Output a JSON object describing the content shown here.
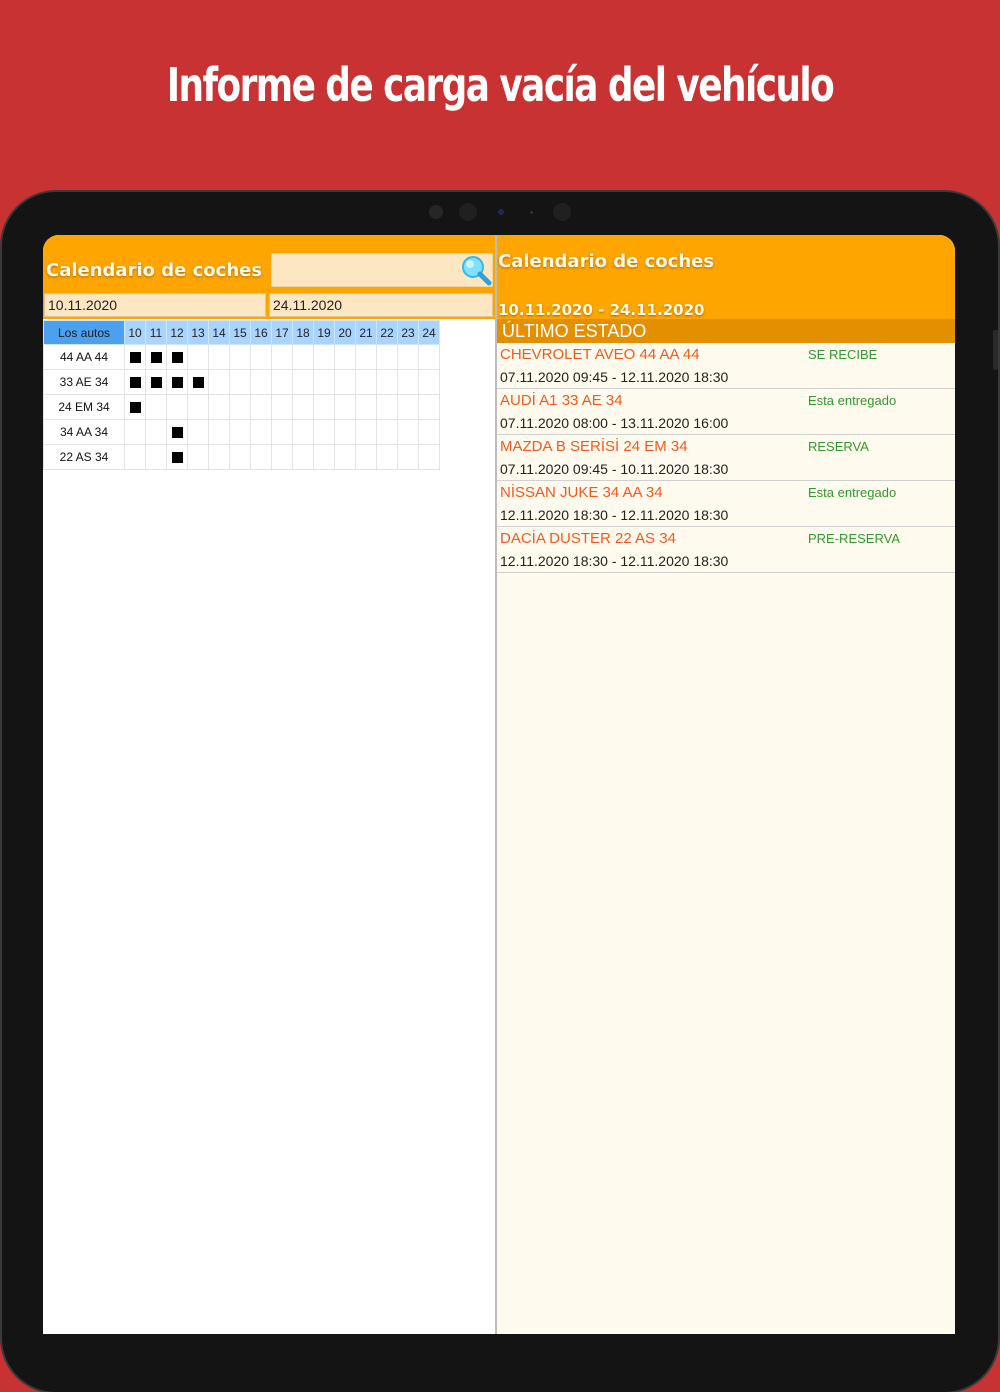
{
  "promo": {
    "title": "Informe de carga vacía del vehículo",
    "bg_color": "#c83232"
  },
  "left": {
    "title": "Calendario de coches",
    "search": {
      "value": "",
      "placeholder": ""
    },
    "date_from": "10.11.2020",
    "date_to": "24.11.2020",
    "grid": {
      "header": "Los autos",
      "days": [
        "10",
        "11",
        "12",
        "13",
        "14",
        "15",
        "16",
        "17",
        "18",
        "19",
        "20",
        "21",
        "22",
        "23",
        "24"
      ],
      "rows": [
        {
          "car": "44 AA 44",
          "booked": [
            "10",
            "11",
            "12"
          ]
        },
        {
          "car": "33 AE 34",
          "booked": [
            "10",
            "11",
            "12",
            "13"
          ]
        },
        {
          "car": "24 EM 34",
          "booked": [
            "10"
          ]
        },
        {
          "car": "34 AA 34",
          "booked": [
            "12"
          ]
        },
        {
          "car": "22 AS 34",
          "booked": [
            "12"
          ]
        }
      ]
    }
  },
  "right": {
    "title": "Calendario de coches",
    "range": "10.11.2020 - 24.11.2020",
    "section": "ÚLTIMO ESTADO",
    "items": [
      {
        "name": "CHEVROLET AVEO 44 AA 44",
        "status": "SE RECIBE",
        "dates": "07.11.2020 09:45  -  12.11.2020 18:30"
      },
      {
        "name": "AUDİ A1 33 AE 34",
        "status": "Esta entregado",
        "dates": "07.11.2020 08:00  -  13.11.2020 16:00"
      },
      {
        "name": "MAZDA B SERİSİ 24 EM 34",
        "status": "RESERVA",
        "dates": "07.11.2020 09:45  -  10.11.2020 18:30"
      },
      {
        "name": "NİSSAN JUKE 34 AA 34",
        "status": "Esta entregado",
        "dates": "12.11.2020 18:30  -  12.11.2020 18:30"
      },
      {
        "name": "DACİA DUSTER 22 AS 34",
        "status": "PRE-RESERVA",
        "dates": "12.11.2020 18:30  -  12.11.2020 18:30"
      }
    ]
  },
  "colors": {
    "header": "#ffa500",
    "section": "#e48f00",
    "car_name": "#f05a1e",
    "status": "#2e9a2e"
  },
  "icons": {
    "search": "magnifier-icon"
  }
}
